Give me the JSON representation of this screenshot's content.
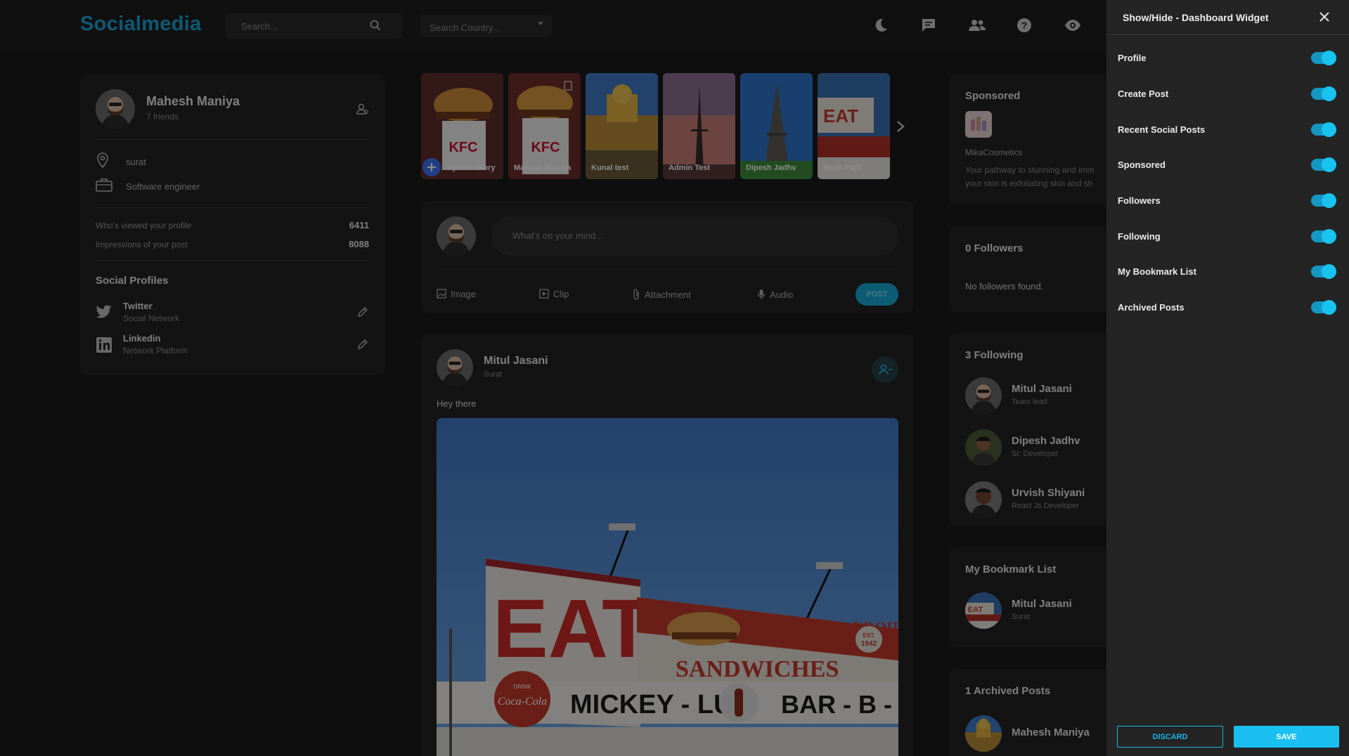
{
  "app": {
    "title": "Socialmedia"
  },
  "search": {
    "placeholder": "Search..."
  },
  "country": {
    "placeholder": "Search Country..."
  },
  "profile": {
    "name": "Mahesh Maniya",
    "friends": "7 friends",
    "location": "surat",
    "occupation": "Software engineer",
    "stats": [
      {
        "label": "Who's viewed your profile",
        "value": "6411"
      },
      {
        "label": "Impressions of your post",
        "value": "8088"
      }
    ],
    "social_title": "Social Profiles",
    "social": [
      {
        "name": "Twitter",
        "type": "Social Network"
      },
      {
        "name": "Linkedin",
        "type": "Network Platform"
      }
    ]
  },
  "stories": {
    "update_label": "Update Story",
    "items": [
      "Mahesh Maniya",
      "Kunal test",
      "Admin Test",
      "Dipesh Jadhv",
      "Raoji Patil"
    ]
  },
  "composer": {
    "placeholder": "What's on your mind...",
    "actions": [
      "Image",
      "Clip",
      "Attachment",
      "Audio"
    ],
    "post_label": "POST"
  },
  "post": {
    "author": "Mitul Jasani",
    "location": "Surat",
    "text": "Hey there",
    "sign": {
      "main": "EAT",
      "top": "CHARCOAL BROILED",
      "middle": "SANDWICHES",
      "left": "MICKEY - LU",
      "right": "BAR - B - Q",
      "badge_top": "EST.",
      "badge_year": "1942",
      "cola": "Coca-Cola",
      "drink": "DRINK"
    }
  },
  "sponsored": {
    "title": "Sponsored",
    "brand": "MikaCosmetics",
    "text_line1": "Your pathway to stunning and imm",
    "text_line2": "your skin is exfoliating skin and sh"
  },
  "followers": {
    "title": "0 Followers",
    "empty": "No followers found."
  },
  "following": {
    "title": "3 Following",
    "items": [
      {
        "name": "Mitul Jasani",
        "role": "Team lead"
      },
      {
        "name": "Dipesh Jadhv",
        "role": "Sr. Developer"
      },
      {
        "name": "Urvish Shiyani",
        "role": "React Js Developer"
      }
    ]
  },
  "bookmarks": {
    "title": "My Bookmark List",
    "items": [
      {
        "name": "Mitul Jasani",
        "location": "Surat"
      }
    ]
  },
  "archived": {
    "title": "1 Archived Posts",
    "items": [
      {
        "name": "Mahesh Maniya"
      }
    ]
  },
  "widget_panel": {
    "title": "Show/Hide - Dashboard Widget",
    "items": [
      {
        "label": "Profile",
        "on": true
      },
      {
        "label": "Create Post",
        "on": true
      },
      {
        "label": "Recent Social Posts",
        "on": true
      },
      {
        "label": "Sponsored",
        "on": true
      },
      {
        "label": "Followers",
        "on": true
      },
      {
        "label": "Following",
        "on": true
      },
      {
        "label": "My Bookmark List",
        "on": true
      },
      {
        "label": "Archived Posts",
        "on": true
      }
    ],
    "discard_label": "DISCARD",
    "save_label": "SAVE"
  },
  "colors": {
    "accent": "#19c0f0",
    "brand": "#1aa3d6",
    "background": "#1a1a1a",
    "card": "#242424"
  }
}
